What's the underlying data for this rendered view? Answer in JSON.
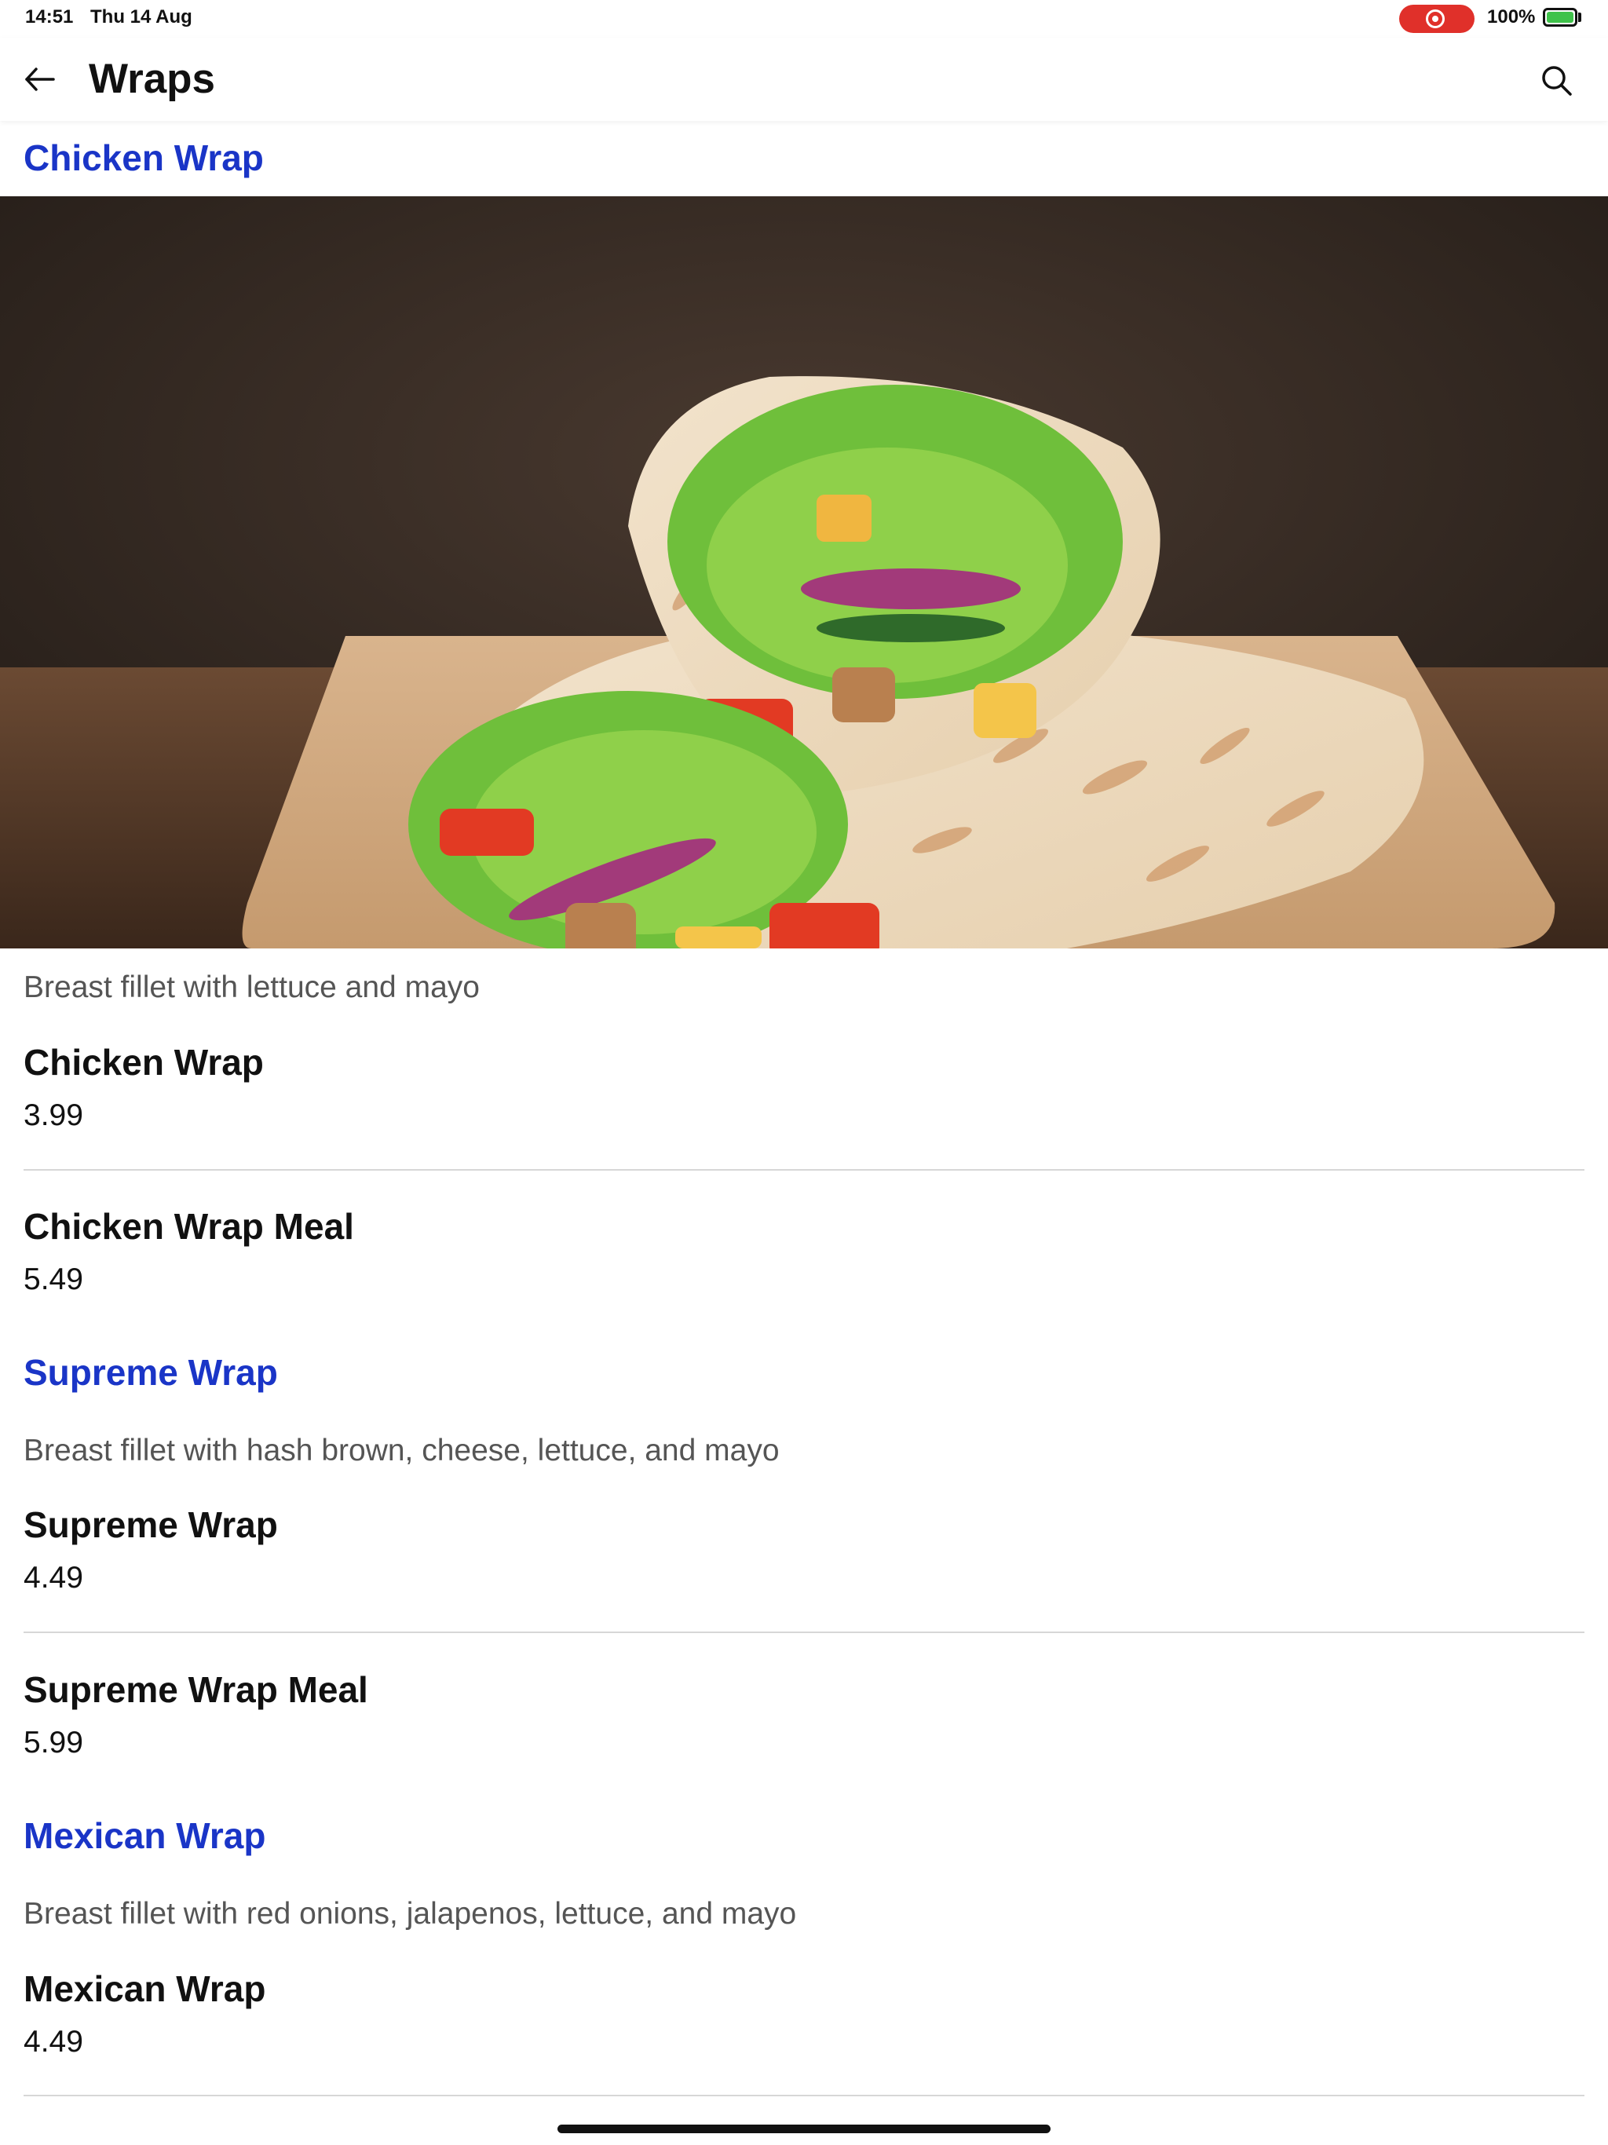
{
  "status_bar": {
    "time": "14:51",
    "date": "Thu 14 Aug",
    "battery": "100%"
  },
  "header": {
    "title": "Wraps",
    "back_icon": "arrow-left-icon",
    "search_icon": "search-icon"
  },
  "colors": {
    "section_title": "#1a35c7",
    "recording": "#e0302a",
    "battery": "#3fc24a"
  },
  "sections": [
    {
      "title": "Chicken Wrap",
      "description": "Breast fillet with lettuce and mayo",
      "items": [
        {
          "name": "Chicken Wrap",
          "price": "3.99"
        },
        {
          "name": "Chicken Wrap Meal",
          "price": "5.49"
        }
      ]
    },
    {
      "title": "Supreme Wrap",
      "description": "Breast fillet with hash brown, cheese, lettuce, and mayo",
      "items": [
        {
          "name": "Supreme Wrap",
          "price": "4.49"
        },
        {
          "name": "Supreme Wrap Meal",
          "price": "5.99"
        }
      ]
    },
    {
      "title": "Mexican Wrap",
      "description": "Breast fillet with red onions, jalapenos, lettuce, and mayo",
      "items": [
        {
          "name": "Mexican Wrap",
          "price": "4.49"
        }
      ]
    }
  ]
}
